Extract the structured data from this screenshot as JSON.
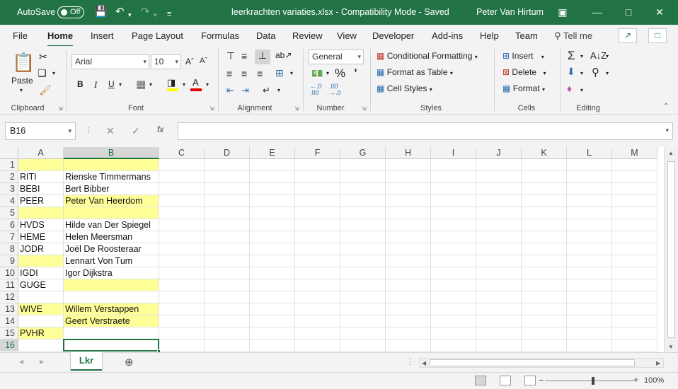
{
  "titlebar": {
    "autosave_label": "AutoSave",
    "autosave_state": "Off",
    "title": "leerkrachten variaties.xlsx  -  Compatibility Mode  -  Saved",
    "user": "Peter Van Hirtum"
  },
  "tabs": [
    "File",
    "Home",
    "Insert",
    "Page Layout",
    "Formulas",
    "Data",
    "Review",
    "View",
    "Developer",
    "Add-ins",
    "Help",
    "Team"
  ],
  "active_tab": "Home",
  "tellme": "Tell me",
  "ribbon": {
    "clipboard": {
      "label": "Clipboard",
      "paste": "Paste"
    },
    "font": {
      "label": "Font",
      "name": "Arial",
      "size": "10"
    },
    "alignment": {
      "label": "Alignment"
    },
    "number": {
      "label": "Number",
      "format": "General"
    },
    "styles": {
      "label": "Styles",
      "conditional": "Conditional Formatting",
      "format_table": "Format as Table",
      "cell_styles": "Cell Styles"
    },
    "cells": {
      "label": "Cells",
      "insert": "Insert",
      "delete": "Delete",
      "format": "Format"
    },
    "editing": {
      "label": "Editing"
    }
  },
  "formula": {
    "namebox": "B16",
    "fx": "fx",
    "content": ""
  },
  "columns": [
    "A",
    "B",
    "C",
    "D",
    "E",
    "F",
    "G",
    "H",
    "I",
    "J",
    "K",
    "L",
    "M"
  ],
  "rows": [
    {
      "n": "1",
      "a": "",
      "b": "",
      "ya": true,
      "yb": true
    },
    {
      "n": "2",
      "a": "RITI",
      "b": "Rienske Timmermans",
      "ya": false,
      "yb": false
    },
    {
      "n": "3",
      "a": "BEBI",
      "b": "Bert Bibber",
      "ya": false,
      "yb": false
    },
    {
      "n": "4",
      "a": "PEER",
      "b": "Peter Van Heerdom",
      "ya": false,
      "yb": true
    },
    {
      "n": "5",
      "a": "",
      "b": "",
      "ya": true,
      "yb": true
    },
    {
      "n": "6",
      "a": "HVDS",
      "b": "Hilde van Der Spiegel",
      "ya": false,
      "yb": false
    },
    {
      "n": "7",
      "a": "HEME",
      "b": "Helen Meersman",
      "ya": false,
      "yb": false
    },
    {
      "n": "8",
      "a": "JODR",
      "b": "Joël De Roosteraar",
      "ya": false,
      "yb": false
    },
    {
      "n": "9",
      "a": "",
      "b": "Lennart Von Tum",
      "ya": true,
      "yb": false
    },
    {
      "n": "10",
      "a": "IGDI",
      "b": "Igor Dijkstra",
      "ya": false,
      "yb": false
    },
    {
      "n": "11",
      "a": "GUGE",
      "b": "",
      "ya": false,
      "yb": true
    },
    {
      "n": "12",
      "a": "",
      "b": "",
      "ya": false,
      "yb": false
    },
    {
      "n": "13",
      "a": "WIVE",
      "b": "Willem Verstappen",
      "ya": true,
      "yb": true
    },
    {
      "n": "14",
      "a": "",
      "b": "Geert Verstraete",
      "ya": false,
      "yb": true
    },
    {
      "n": "15",
      "a": "PVHR",
      "b": "",
      "ya": true,
      "yb": false
    },
    {
      "n": "16",
      "a": "",
      "b": "",
      "ya": false,
      "yb": false
    }
  ],
  "sheet_tab": "Lkr",
  "status": {
    "zoom": "100%"
  },
  "colors": {
    "accent": "#217346",
    "highlight": "#ffff99"
  }
}
